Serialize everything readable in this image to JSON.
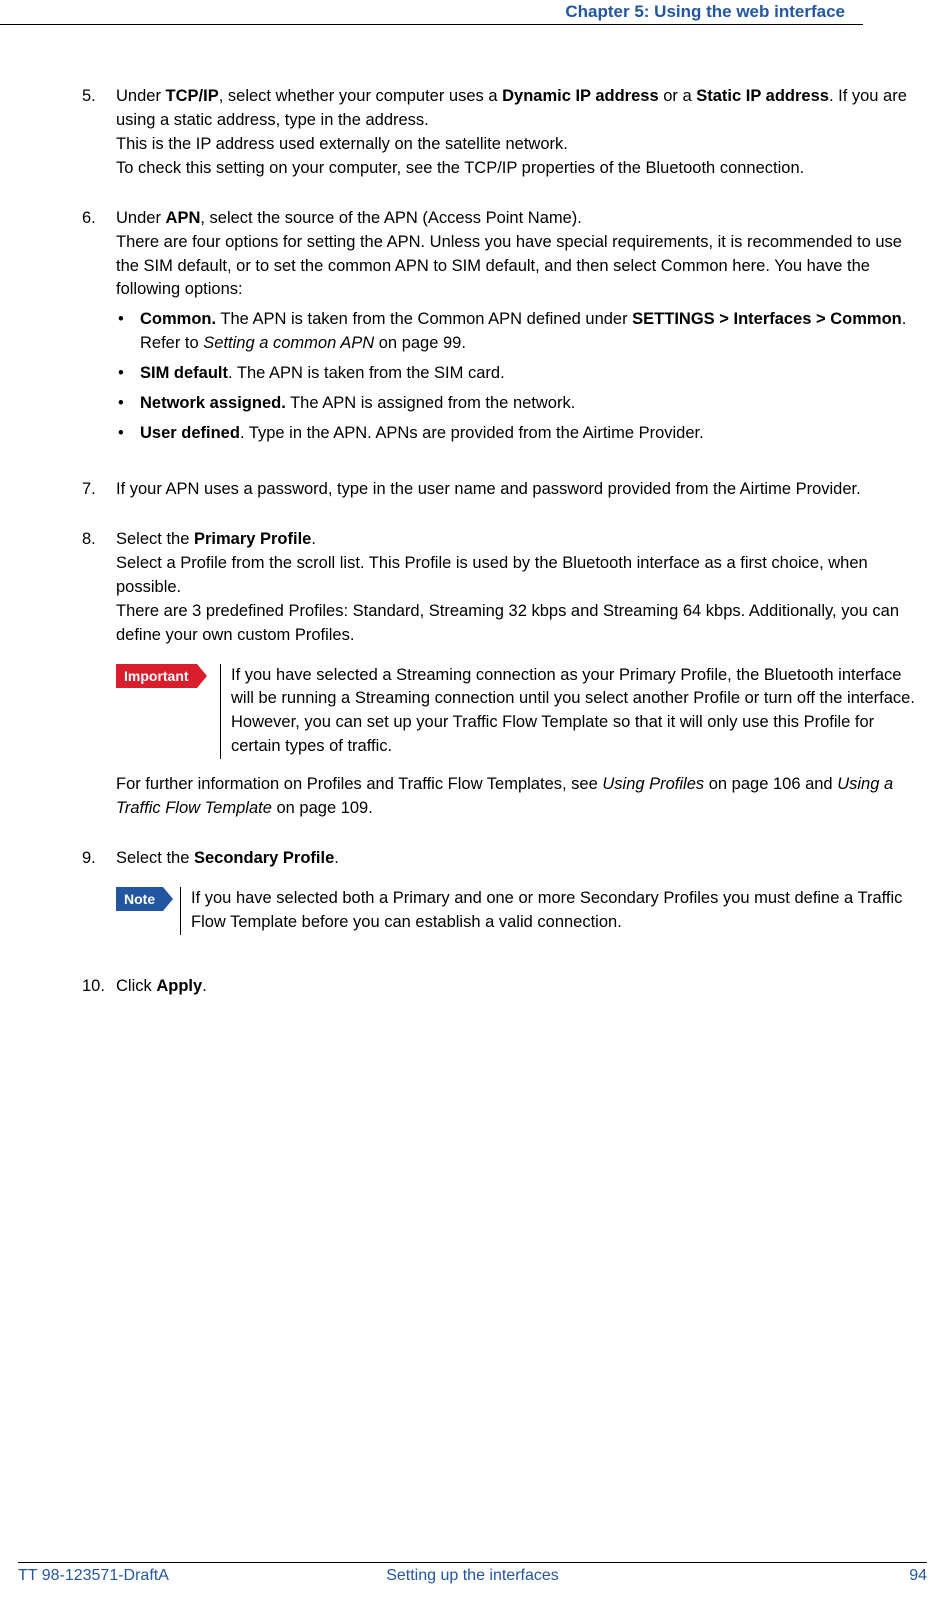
{
  "header": {
    "chapter": "Chapter 5: Using the web interface"
  },
  "footer": {
    "doc_id": "TT 98-123571-DraftA",
    "section": "Setting up the interfaces",
    "page": "94"
  },
  "steps": {
    "s5": {
      "num": "5.",
      "p1a": "Under ",
      "p1b": "TCP/IP",
      "p1c": ", select whether your computer uses a ",
      "p1d": "Dynamic IP address",
      "p1e": " or a ",
      "p1f": "Static IP address",
      "p1g": ". If you are using a static address, type in the address.",
      "p2": "This is the IP address used externally on the satellite network.",
      "p3": "To check this setting on your computer, see the TCP/IP properties of the Bluetooth connection."
    },
    "s6": {
      "num": "6.",
      "p1a": "Under ",
      "p1b": "APN",
      "p1c": ", select the source of the APN (Access Point Name).",
      "p2": "There are four options for setting the APN. Unless you have special requirements, it is recommended to use the SIM default, or to set the common APN to SIM default, and then select Common here. You have the following options:",
      "b1a": "Common.",
      "b1b": " The APN is taken from the Common APN defined under ",
      "b1c": "SETTINGS > Interfaces > Common",
      "b1d": ". Refer to ",
      "b1e": "Setting a common APN",
      "b1f": " on page 99.",
      "b2a": "SIM default",
      "b2b": ". The APN is taken from the SIM card.",
      "b3a": "Network assigned.",
      "b3b": " The APN is assigned from the network.",
      "b4a": "User defined",
      "b4b": ". Type in the APN. APNs are provided from the Airtime Provider."
    },
    "s7": {
      "num": "7.",
      "p1": "If your APN uses a password, type in the user name and password provided from the Airtime Provider."
    },
    "s8": {
      "num": "8.",
      "p1a": "Select the ",
      "p1b": "Primary Profile",
      "p1c": ".",
      "p2": "Select a Profile from the scroll list. This Profile is used by the Bluetooth interface as a first choice, when possible.",
      "p3": "There are 3 predefined Profiles: Standard, Streaming 32 kbps and Streaming 64 kbps. Additionally, you can define your own custom Profiles.",
      "callout_label": "Important",
      "callout_text": "If you have selected a Streaming connection as your Primary Profile, the Bluetooth interface will be running a Streaming connection until you select another Profile or turn off the interface. However, you can set up your Traffic Flow Template so that it will only use this Profile for certain types of traffic.",
      "p4a": "For further information on Profiles and Traffic Flow Templates, see ",
      "p4b": "Using Profiles",
      "p4c": " on page 106 and ",
      "p4d": "Using a Traffic Flow Template",
      "p4e": " on page 109."
    },
    "s9": {
      "num": "9.",
      "p1a": "Select the ",
      "p1b": "Secondary Profile",
      "p1c": ".",
      "callout_label": "Note",
      "callout_text": "If you have selected both a Primary and one or more Secondary Profiles you must define a Traffic Flow Template before you can establish a valid connection."
    },
    "s10": {
      "num": "10.",
      "p1a": "Click ",
      "p1b": "Apply",
      "p1c": "."
    }
  }
}
